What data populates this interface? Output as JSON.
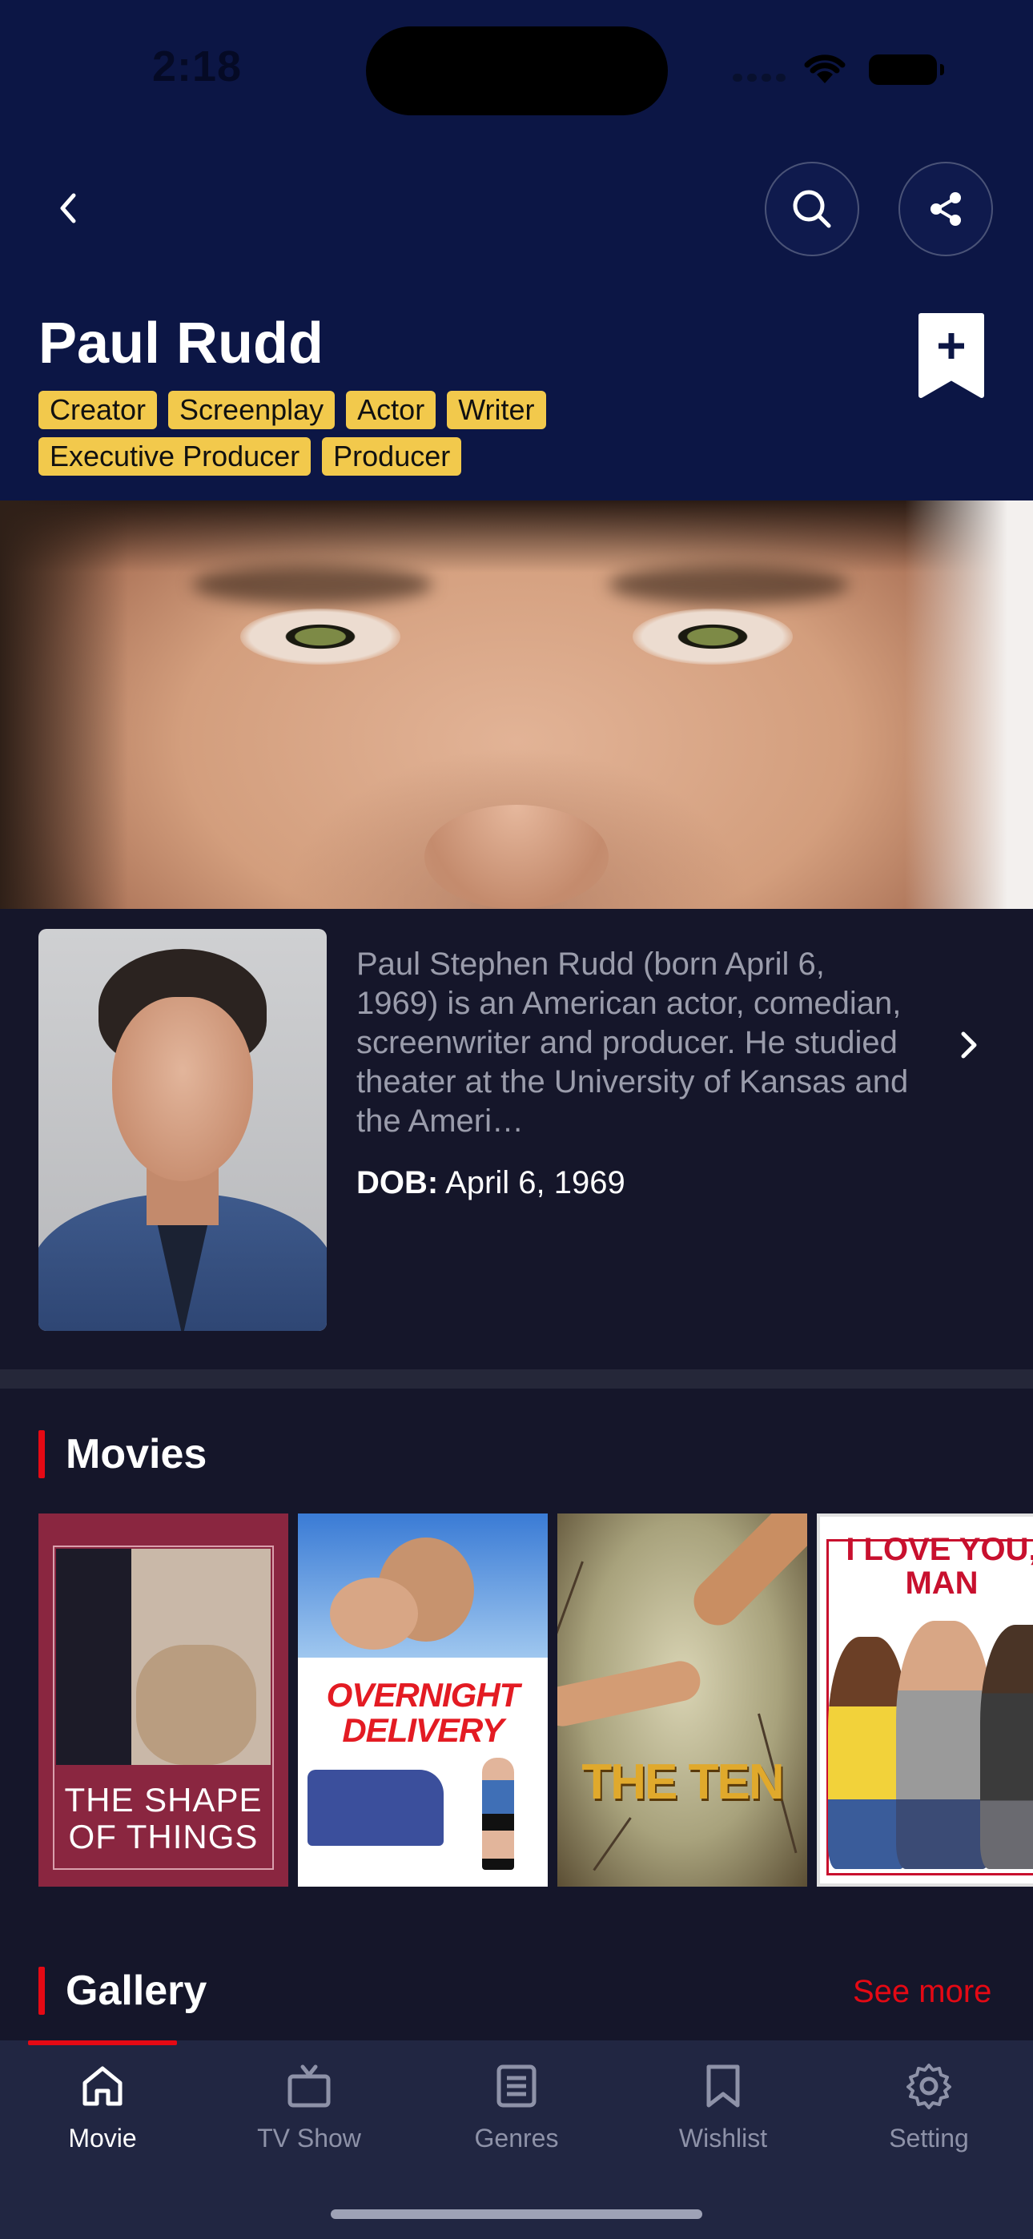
{
  "status_bar": {
    "time": "2:18"
  },
  "person": {
    "name": "Paul Rudd",
    "roles": [
      "Creator",
      "Screenplay",
      "Actor",
      "Writer",
      "Executive Producer",
      "Producer"
    ],
    "bio": "Paul Stephen Rudd (born April 6, 1969) is an American actor, comedian, screenwriter and producer. He studied theater at the University of Kansas and the Ameri…",
    "dob_label": "DOB:",
    "dob_value": "April 6, 1969"
  },
  "sections": {
    "movies_title": "Movies",
    "gallery_title": "Gallery",
    "see_more": "See more"
  },
  "movies": [
    {
      "title": "THE SHAPE\nOF THINGS"
    },
    {
      "title": "OVERNIGHT\nDELIVERY"
    },
    {
      "title": "THE TEN"
    },
    {
      "title": "I LOVE YOU,\nMAN"
    }
  ],
  "tabs": [
    {
      "label": "Movie",
      "icon": "home-icon",
      "active": true
    },
    {
      "label": "TV Show",
      "icon": "tv-icon",
      "active": false
    },
    {
      "label": "Genres",
      "icon": "list-icon",
      "active": false
    },
    {
      "label": "Wishlist",
      "icon": "bookmark-icon",
      "active": false
    },
    {
      "label": "Setting",
      "icon": "gear-icon",
      "active": false
    }
  ],
  "colors": {
    "header_bg": "#0c1645",
    "body_bg": "#15162a",
    "role_badge": "#f2c94c",
    "accent_red": "#e50914",
    "tabbar_bg": "#212642"
  }
}
